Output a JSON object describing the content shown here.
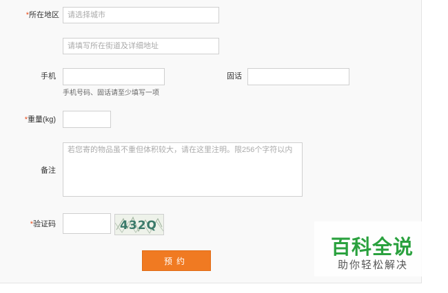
{
  "form": {
    "region": {
      "required_mark": "*",
      "label": "所在地区",
      "city_placeholder": "请选择城市",
      "address_placeholder": "请填写所在街道及详细地址"
    },
    "mobile": {
      "label": "手机",
      "value": ""
    },
    "phone": {
      "label": "固话",
      "value": ""
    },
    "contact_hint": "手机号码、固话请至少填写一项",
    "weight": {
      "required_mark": "*",
      "label": "重量(kg)",
      "value": ""
    },
    "remark": {
      "label": "备注",
      "placeholder": "若您寄的物品虽不重但体积较大，请在这里注明。限256个字符以内"
    },
    "captcha": {
      "required_mark": "*",
      "label": "验证码",
      "value": "",
      "image_text": "432Q"
    },
    "submit_label": "预约"
  },
  "watermark": {
    "title": "百科全说",
    "subtitle": "助你轻松解决"
  },
  "colors": {
    "accent": "#f07a22",
    "required": "#e84c1c",
    "watermark_green": "#2aa13e"
  }
}
